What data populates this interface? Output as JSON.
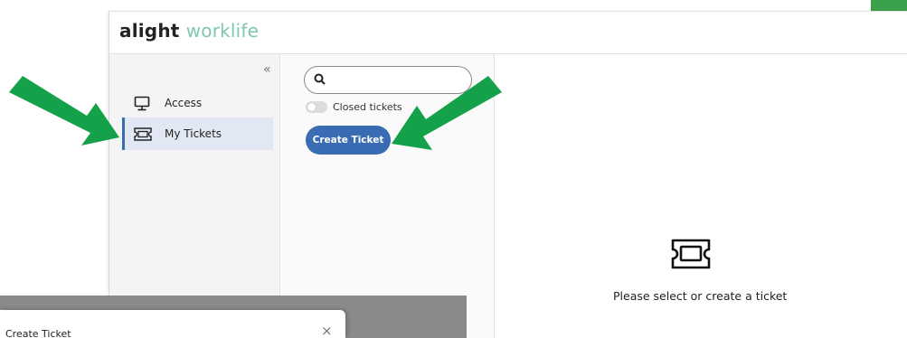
{
  "header": {
    "logo_word1": "alight",
    "logo_word2": "worklife"
  },
  "sidebar": {
    "collapse_glyph": "«",
    "items": [
      {
        "label": "Access",
        "icon": "monitor-icon"
      },
      {
        "label": "My Tickets",
        "icon": "ticket-icon",
        "selected": true
      }
    ]
  },
  "list": {
    "search_placeholder": "",
    "closed_toggle_label": "Closed tickets",
    "create_button_label": "Create Ticket"
  },
  "empty_state": {
    "message": "Please select or create a ticket",
    "icon": "ticket-icon"
  },
  "modal": {
    "title": "Create Ticket",
    "close_glyph": "×"
  },
  "colors": {
    "primary": "#3a6cb4",
    "accent_teal": "#7fc6b2",
    "annotation_green": "#15a14a"
  }
}
